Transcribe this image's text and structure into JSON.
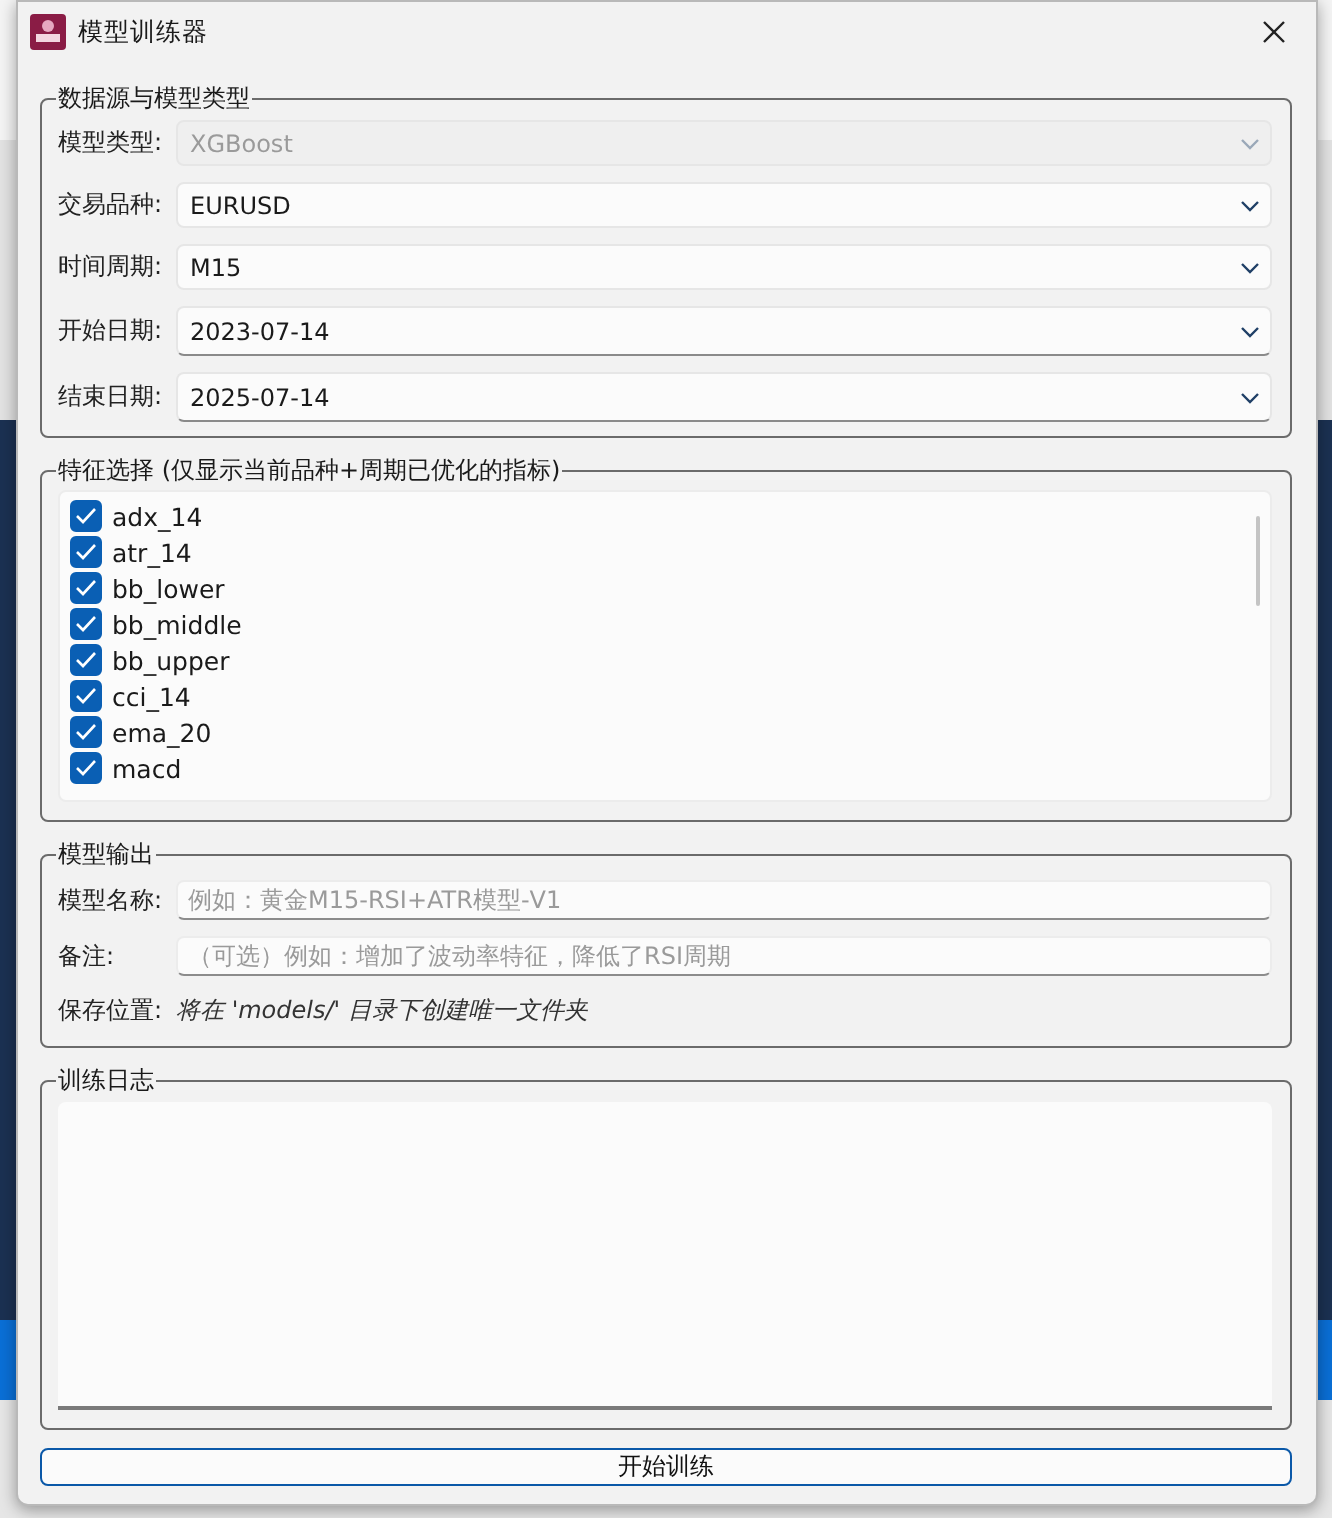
{
  "window": {
    "title": "模型训练器"
  },
  "data_source": {
    "title": "数据源与模型类型",
    "fields": [
      {
        "label": "模型类型:",
        "value": "XGBoost",
        "disabled": true,
        "kind": "combo"
      },
      {
        "label": "交易品种:",
        "value": "EURUSD",
        "disabled": false,
        "kind": "combo"
      },
      {
        "label": "时间周期:",
        "value": "M15",
        "disabled": false,
        "kind": "combo"
      },
      {
        "label": "开始日期:",
        "value": "2023-07-14",
        "disabled": false,
        "kind": "date"
      },
      {
        "label": "结束日期:",
        "value": "2025-07-14",
        "disabled": false,
        "kind": "date"
      }
    ]
  },
  "features": {
    "title": "特征选择 (仅显示当前品种+周期已优化的指标)",
    "items": [
      {
        "label": "adx_14",
        "checked": true
      },
      {
        "label": "atr_14",
        "checked": true
      },
      {
        "label": "bb_lower",
        "checked": true
      },
      {
        "label": "bb_middle",
        "checked": true
      },
      {
        "label": "bb_upper",
        "checked": true
      },
      {
        "label": "cci_14",
        "checked": true
      },
      {
        "label": "ema_20",
        "checked": true
      },
      {
        "label": "macd",
        "checked": true
      }
    ]
  },
  "output": {
    "title": "模型输出",
    "fields": [
      {
        "label": "模型名称:",
        "placeholder": "例如：黄金M15-RSI+ATR模型-V1"
      },
      {
        "label": "备注:",
        "placeholder": "（可选）例如：增加了波动率特征，降低了RSI周期"
      }
    ],
    "save": {
      "label": "保存位置:",
      "value": "将在 'models/' 目录下创建唯一文件夹"
    }
  },
  "log": {
    "title": "训练日志"
  },
  "button": {
    "label": "开始训练"
  }
}
